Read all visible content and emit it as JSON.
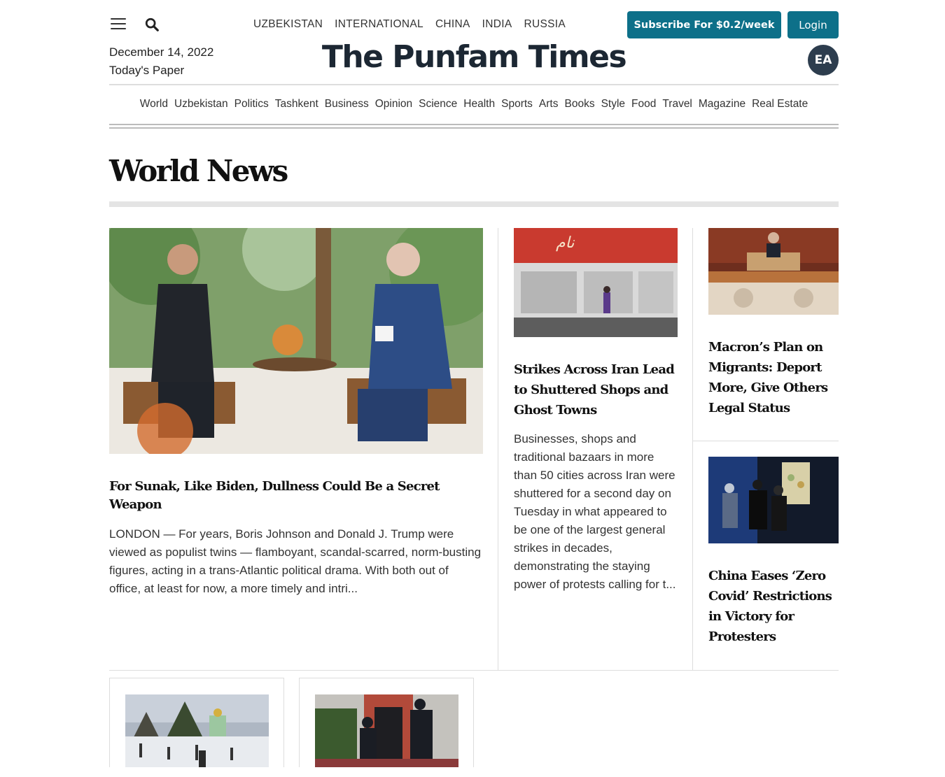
{
  "header": {
    "region_nav": [
      "UZBEKISTAN",
      "INTERNATIONAL",
      "CHINA",
      "INDIA",
      "RUSSIA"
    ],
    "subscribe_label": "Subscribe For $0.2/week",
    "login_label": "Login",
    "date": "December 14, 2022",
    "todays_paper": "Today's Paper",
    "masthead": "The Punfam Times",
    "avatar_initials": "EA",
    "accent_color": "#0d7089"
  },
  "section_nav": [
    "World",
    "Uzbekistan",
    "Politics",
    "Tashkent",
    "Business",
    "Opinion",
    "Science",
    "Health",
    "Sports",
    "Arts",
    "Books",
    "Style",
    "Food",
    "Travel",
    "Magazine",
    "Real Estate"
  ],
  "section": {
    "title": "World News"
  },
  "articles": {
    "lead": {
      "headline": "For Sunak, Like Biden, Dullness Could Be a Secret Weapon",
      "summary": "LONDON — For years, Boris Johnson and Donald J. Trump were viewed as populist twins — flamboyant, scandal-scarred, norm-busting figures, acting in a trans-Atlantic political drama. With both out of office, at least for now, a more timely and intri..."
    },
    "middle": {
      "headline": "Strikes Across Iran Lead to Shuttered Shops and Ghost Towns",
      "summary": "Businesses, shops and traditional bazaars in more than 50 cities across Iran were shuttered for a second day on Tuesday in what appeared to be one of the largest general strikes in decades, demonstrating the staying power of protests calling for t..."
    },
    "side1": {
      "headline": "Macron’s Plan on Migrants: Deport More, Give Others Legal Status"
    },
    "side2": {
      "headline": "China Eases ‘Zero Covid’ Restrictions in Victory for Protesters"
    }
  }
}
